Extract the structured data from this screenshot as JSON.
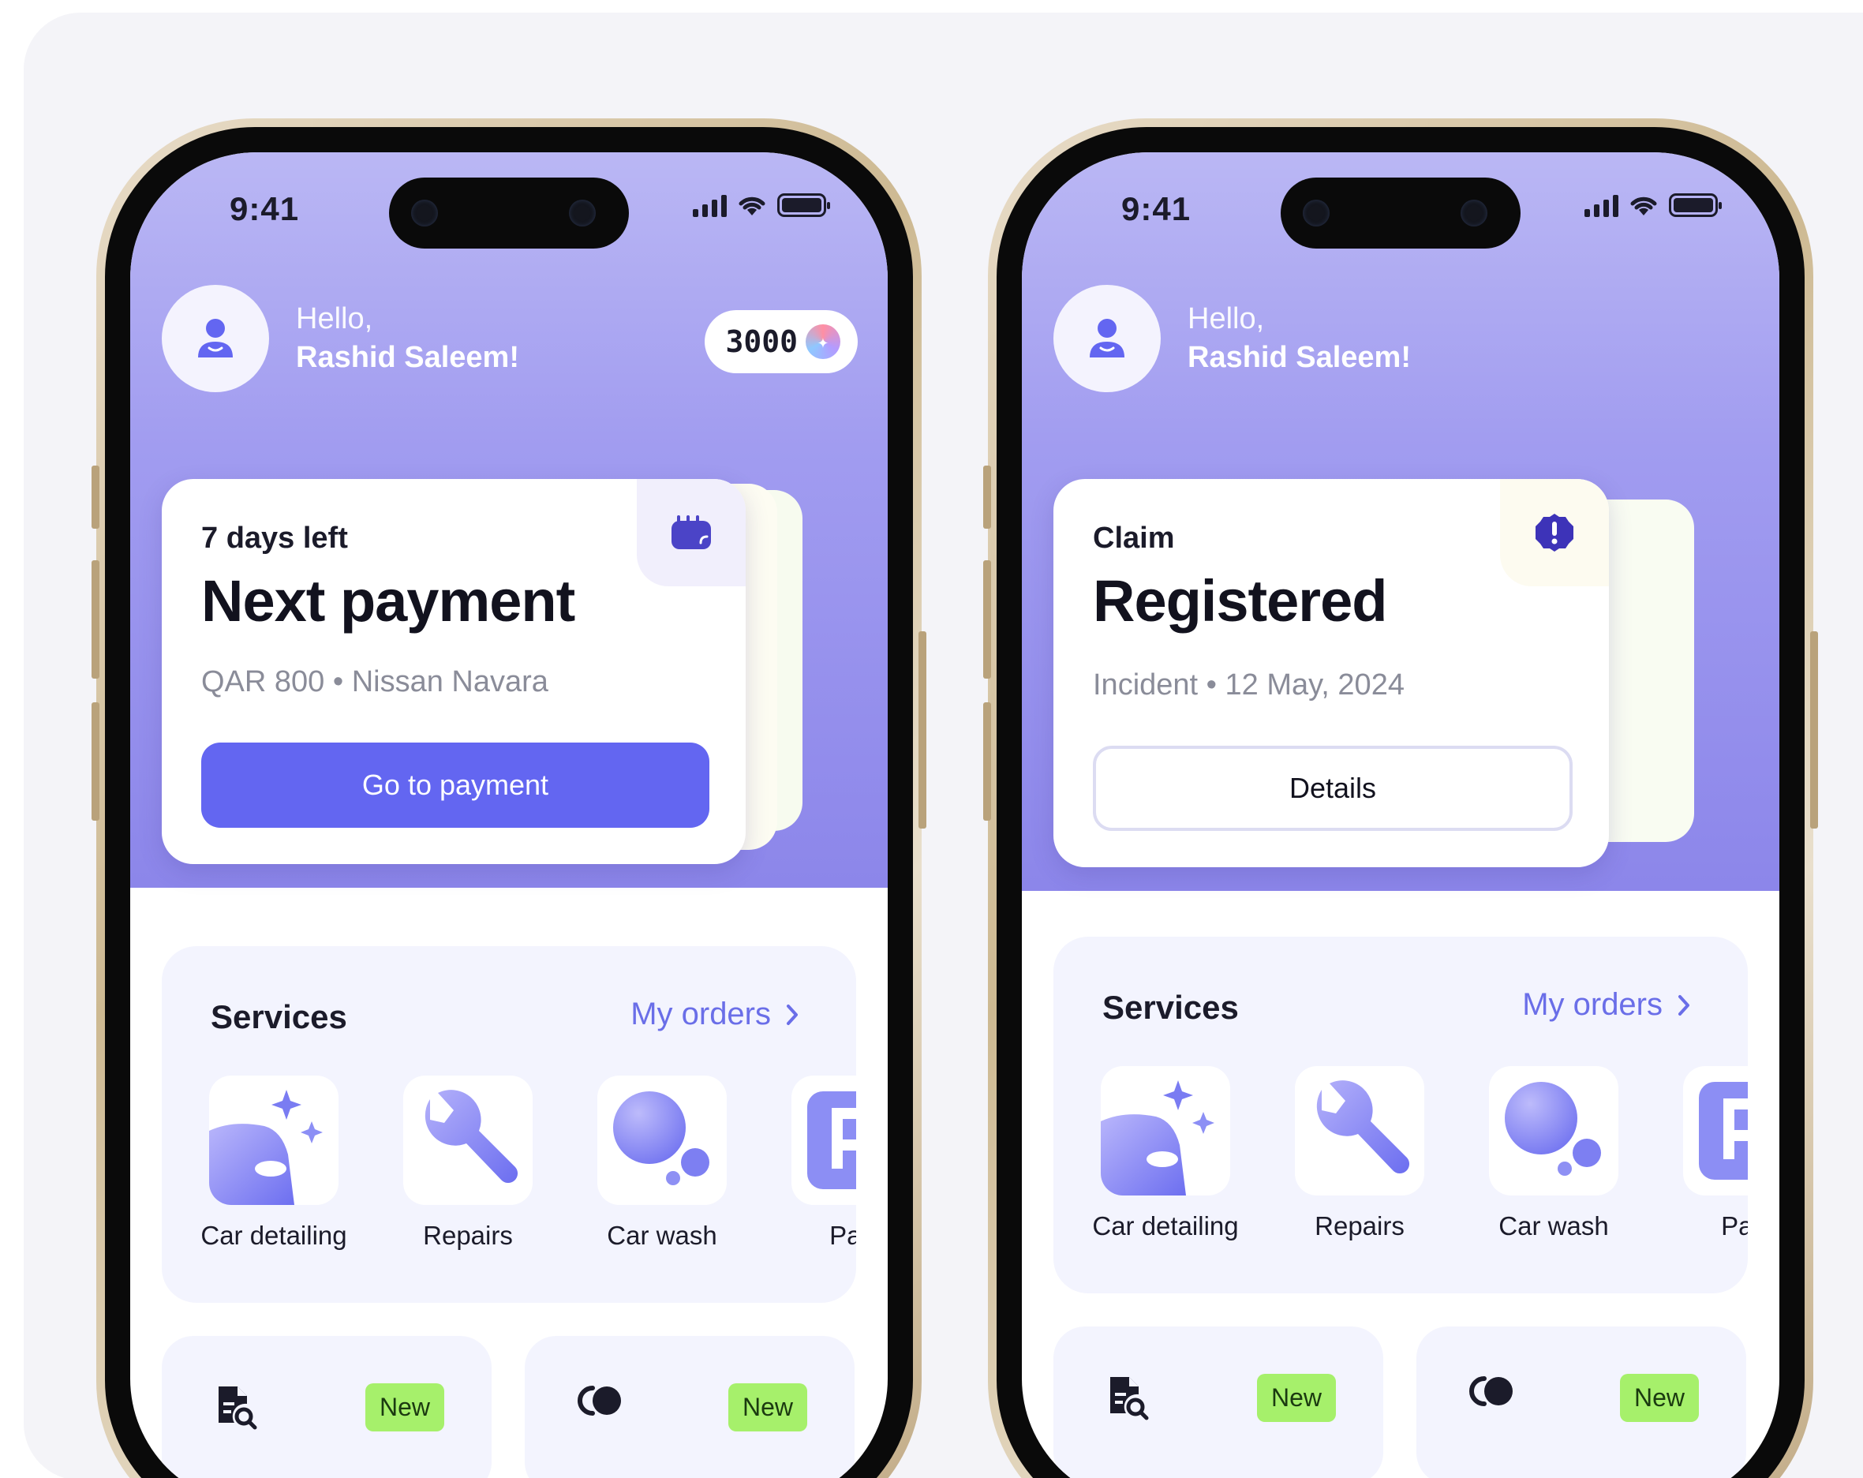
{
  "status_time": "9:41",
  "greeting": {
    "hello": "Hello,",
    "name": "Rashid Saleem!"
  },
  "points": "3000",
  "phones": [
    {
      "card": {
        "kicker": "7 days left",
        "headline": "Next payment",
        "meta": "QAR 800 • Nissan Navara",
        "cta": "Go to payment",
        "corner_icon": "wallet-icon"
      }
    },
    {
      "card": {
        "kicker": "Claim",
        "headline": "Registered",
        "meta": "Incident • 12 May, 2024",
        "cta": "Details",
        "corner_icon": "alert-icon"
      }
    }
  ],
  "services": {
    "title": "Services",
    "link": "My orders",
    "items": [
      {
        "label": "Car detailing",
        "icon": "car-sparkle-icon"
      },
      {
        "label": "Repairs",
        "icon": "wrench-icon"
      },
      {
        "label": "Car wash",
        "icon": "bubbles-icon"
      },
      {
        "label": "Park",
        "icon": "parking-icon"
      }
    ]
  },
  "mini_cards": [
    {
      "icon": "document-search-icon",
      "badge": "New"
    },
    {
      "icon": "toggle-icon",
      "badge": "New"
    }
  ],
  "colors": {
    "accent": "#6366f1",
    "hero_top": "#bab7f4",
    "hero_bottom": "#8c86ea",
    "badge": "#a6f06b",
    "link": "#6a6ee8"
  }
}
